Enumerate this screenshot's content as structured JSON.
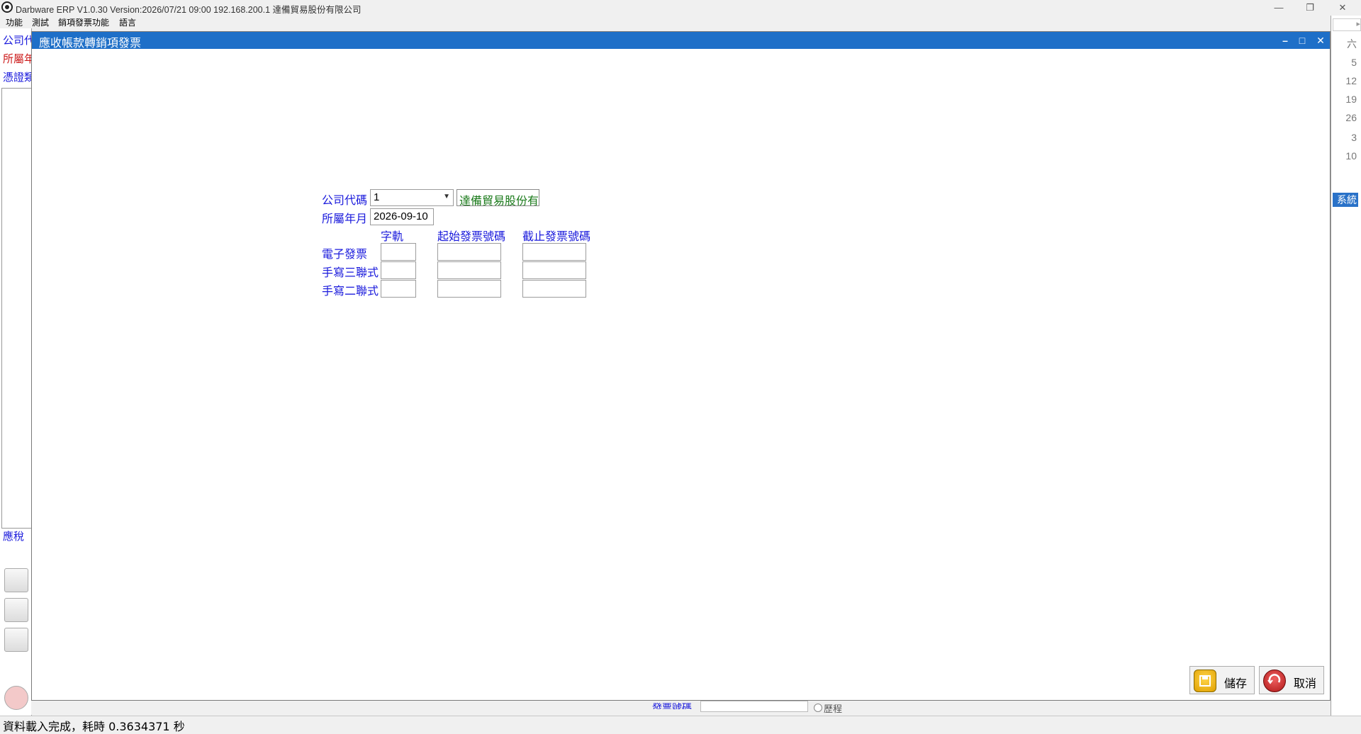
{
  "app": {
    "title": "Darbware ERP V1.0.30 Version:2026/07/21 09:00   192.168.200.1 達備貿易股份有限公司",
    "menu": [
      "功能",
      "測試",
      "銷項發票功能",
      "語言"
    ]
  },
  "parent": {
    "left_labels": [
      "公司代",
      "所屬年",
      "憑證類",
      "應稅"
    ],
    "calendar_days": [
      "六",
      "5",
      "12",
      "19",
      "26",
      "3",
      "10"
    ],
    "bottom_label": "發票號碼",
    "history_label": "歷程",
    "right_buttons": [
      "系統"
    ]
  },
  "dialog": {
    "title": "應收帳款轉銷項發票",
    "company_code_label": "公司代碼",
    "company_code_value": "1",
    "company_name": "達備貿易股份有",
    "period_label": "所屬年月",
    "period_value": "2026-09-10",
    "headers": [
      "字軌",
      "起始發票號碼",
      "截止發票號碼"
    ],
    "rows": [
      {
        "label": "電子發票",
        "track": "",
        "start": "",
        "end": ""
      },
      {
        "label": "手寫三聯式",
        "track": "",
        "start": "",
        "end": ""
      },
      {
        "label": "手寫二聯式",
        "track": "",
        "start": "",
        "end": ""
      }
    ],
    "save_label": "儲存",
    "cancel_label": "取消"
  },
  "status": {
    "text": "資料載入完成，耗時 0.3634371 秒"
  },
  "colors": {
    "dialog_titlebar": "#1e6fc8",
    "label_blue": "#1a1adc",
    "label_red": "#cc1a1a",
    "company_name_green": "#1a7a1a"
  }
}
